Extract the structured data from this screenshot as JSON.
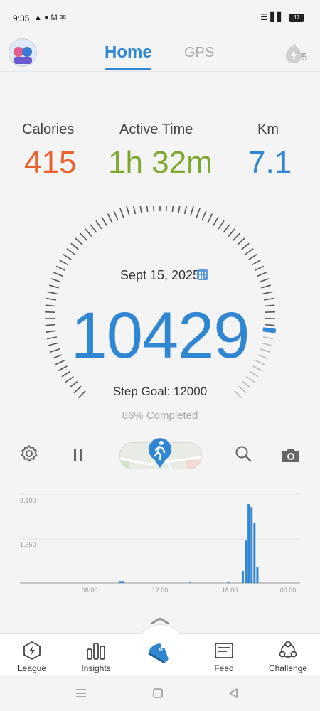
{
  "status_bar": {
    "time": "9:35",
    "battery": "47"
  },
  "header": {
    "tabs": {
      "home": "Home",
      "gps": "GPS"
    },
    "streak_count": "5"
  },
  "stats": {
    "calories": {
      "label": "Calories",
      "value": "415",
      "color": "#e8602c"
    },
    "active_time": {
      "label": "Active Time",
      "value": "1h 32m",
      "color": "#7ea82e"
    },
    "km": {
      "label": "Km",
      "value": "7.1",
      "color": "#2f86d2"
    }
  },
  "gauge": {
    "date": "Sept 15, 2025",
    "steps": "10429",
    "goal": "Step Goal: 12000",
    "completed": "86% Completed",
    "progress": 0.86
  },
  "chart_data": {
    "type": "bar",
    "y_ticks": [
      "3,100",
      "1,550"
    ],
    "x_ticks": [
      "06:00",
      "12:00",
      "18:00",
      "00:00"
    ],
    "ylim": [
      0,
      3100
    ],
    "x": [
      8.5,
      8.75,
      14.5,
      17.75,
      19.0,
      19.25,
      19.5,
      19.75,
      20.0,
      20.25,
      20.5
    ],
    "values": [
      70,
      70,
      40,
      50,
      420,
      1480,
      2750,
      2650,
      2100,
      550,
      0
    ]
  },
  "nav": {
    "league": "League",
    "insights": "Insights",
    "feed": "Feed",
    "challenge": "Challenge"
  },
  "colors": {
    "accent": "#2f86d2"
  }
}
